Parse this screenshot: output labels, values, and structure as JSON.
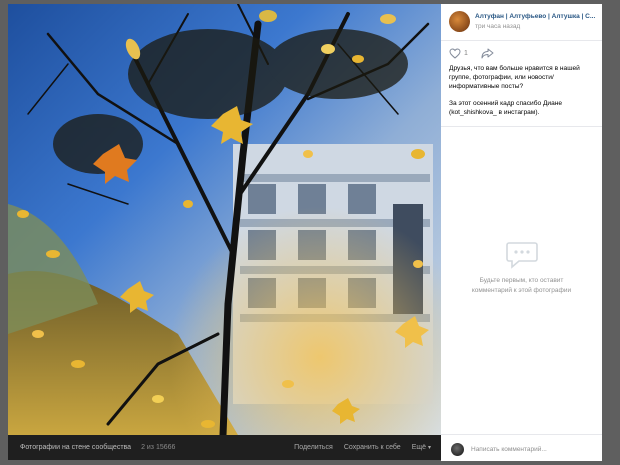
{
  "photo": {
    "album_label": "Фотографии на стене сообщества",
    "counter": "2 из 15666",
    "actions": {
      "share": "Поделиться",
      "save": "Сохранить к себе",
      "more": "Ещё"
    }
  },
  "post": {
    "author": "Алтуфан | Алтуфьево | Алтушка | С...",
    "time": "три часа назад",
    "likes": "1",
    "text_question": "Друзья, что вам больше нравится в нашей группе, фотографии, или новости/информативные посты?",
    "text_thanks": "За этот осенний кадр спасибо Диане (kot_shishkova_ в инстаграм)."
  },
  "comments": {
    "empty_text": "Будьте первым, кто оставит комментарий к этой фотографии",
    "placeholder": "Написать комментарий..."
  },
  "colors": {
    "link": "#2a5885",
    "muted": "#939393",
    "backdrop": "#5f5f5f",
    "leaf_yellow": "#e8b632",
    "leaf_orange": "#e07a1f",
    "sky_blue": "#2f6fc7"
  },
  "icons": {
    "like": "heart-icon",
    "share": "share-arrow-icon",
    "more": "chevron-down-icon",
    "empty_comments": "speech-bubble-icon"
  }
}
